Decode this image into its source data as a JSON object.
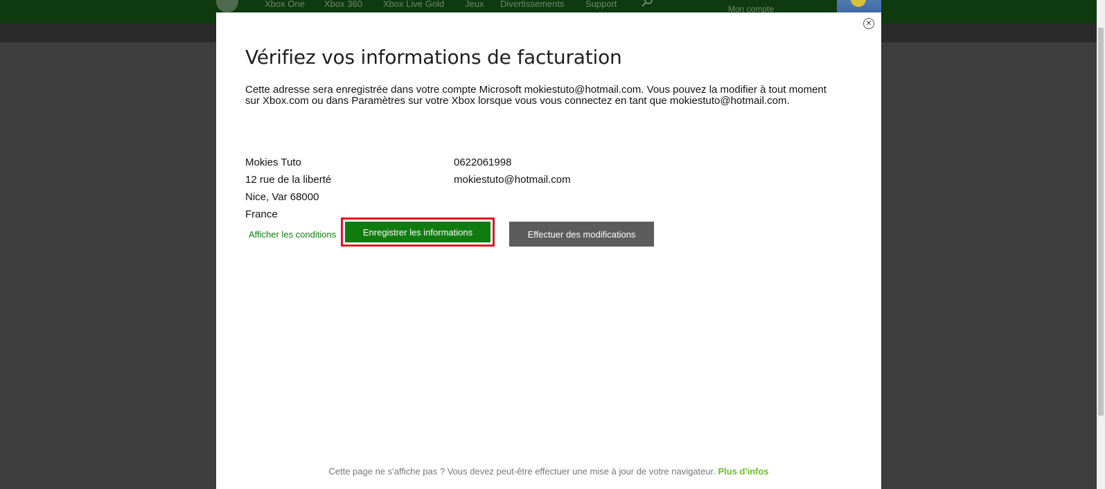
{
  "nav": {
    "items": [
      "Xbox One",
      "Xbox 360",
      "Xbox Live Gold",
      "Jeux",
      "Divertissements",
      "Support"
    ],
    "account_label": "Mon compte"
  },
  "modal": {
    "title": "Vérifiez vos informations de facturation",
    "description": "Cette adresse sera enregistrée dans votre compte Microsoft mokiestuto@hotmail.com. Vous pouvez la modifier à tout moment sur Xbox.com ou dans Paramètres sur votre Xbox lorsque vous vous connectez en tant que mokiestuto@hotmail.com.",
    "address": {
      "name": "Mokies Tuto",
      "street": "12 rue de la liberté",
      "city_line": "Nice, Var 68000",
      "country": "France"
    },
    "contact": {
      "phone": "0622061998",
      "email": "mokiestuto@hotmail.com"
    },
    "terms_link": "Afficher les conditions",
    "save_button": "Enregistrer les informations",
    "edit_button": "Effectuer des modifications",
    "close_icon": "close-circle-icon"
  },
  "footer": {
    "text": "Cette page ne s'affiche pas ? Vous devez peut-être effectuer une mise à jour de votre navigateur.",
    "link": "Plus d'infos"
  },
  "colors": {
    "brand_green": "#107c10",
    "highlight_red": "#e1141f",
    "secondary_button": "#5c5c5c",
    "link_green": "#6bbd2a"
  }
}
